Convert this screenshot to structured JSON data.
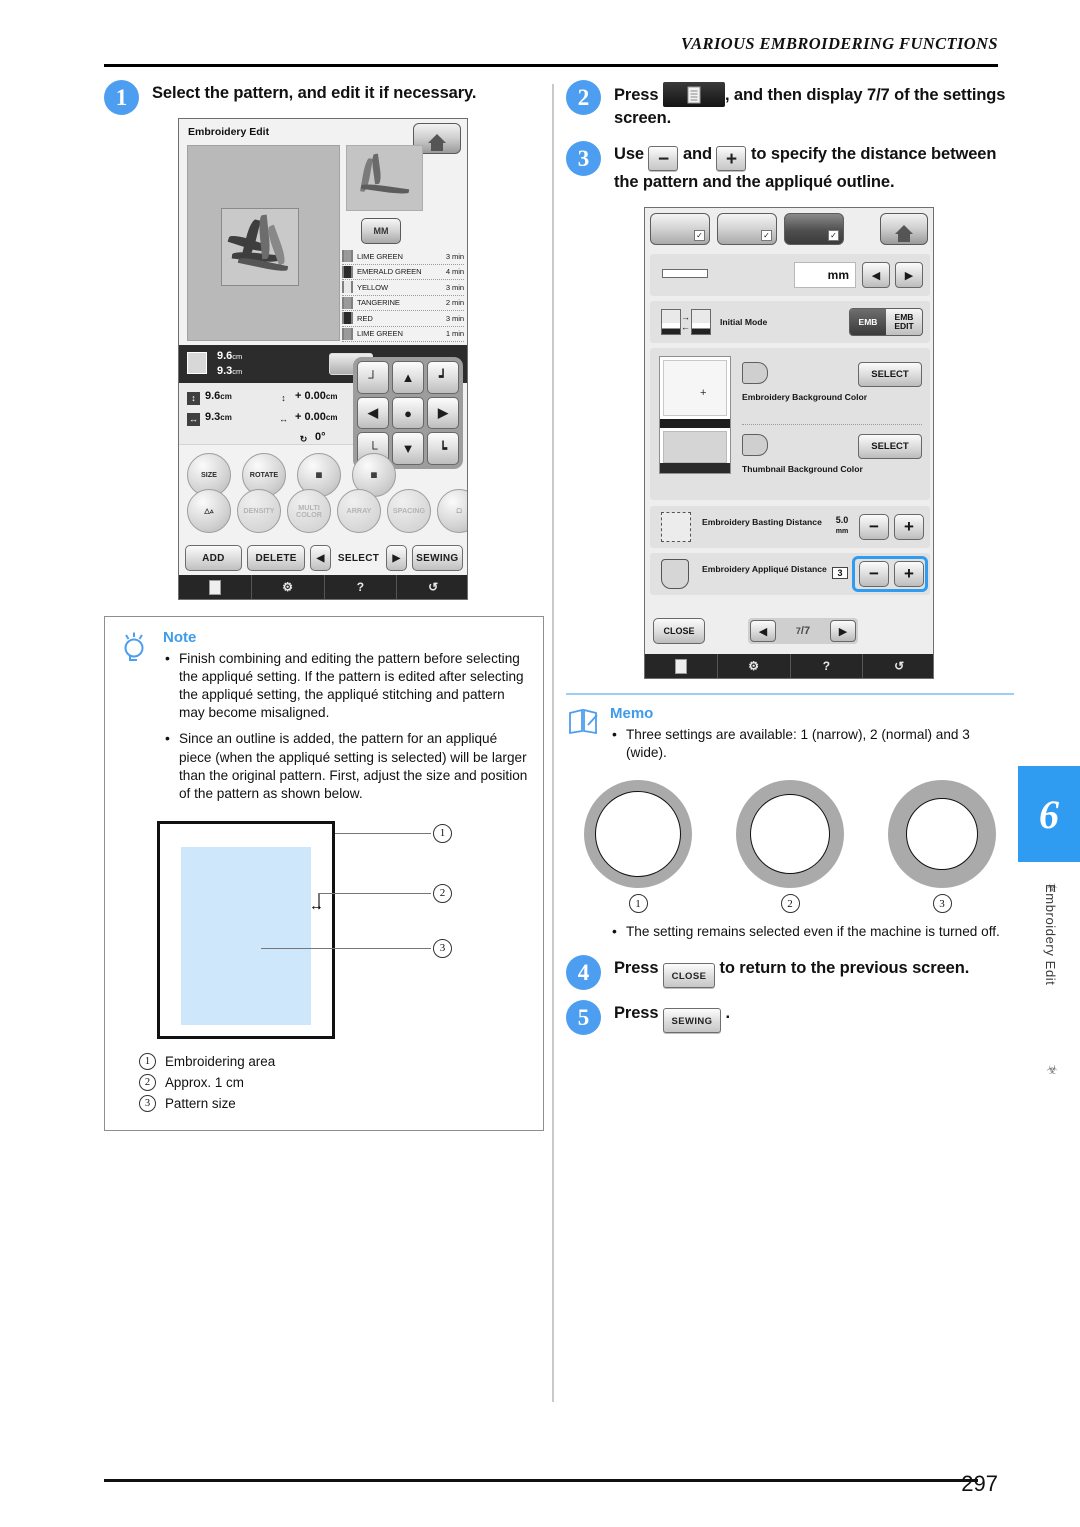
{
  "header": {
    "title": "VARIOUS EMBROIDERING FUNCTIONS"
  },
  "footer": {
    "page_number": "297"
  },
  "sidebar": {
    "chapter_number": "6",
    "chapter_label": "Embroidery Edit"
  },
  "steps": {
    "step1": {
      "num": "1",
      "text": "Select the pattern, and edit it if necessary."
    },
    "step2": {
      "num": "2",
      "text_before": "Press",
      "text_after": ", and then display 7/7 of the settings screen."
    },
    "step3": {
      "num": "3",
      "text_before": "Use",
      "text_mid": "and",
      "text_after": "to specify the distance between the pattern and the appliqué outline.",
      "minus": "−",
      "plus": "+"
    },
    "step4": {
      "num": "4",
      "text_before": "Press",
      "button": "CLOSE",
      "text_after": "to return to the previous screen."
    },
    "step5": {
      "num": "5",
      "text_before": "Press",
      "button": "SEWING",
      "text_after": "."
    }
  },
  "embroidery_edit_screen": {
    "title": "Embroidery Edit",
    "home_icon": "home-icon",
    "thread_colors": [
      {
        "name": "LIME GREEN",
        "time": "3 min",
        "swatch": "s-mid"
      },
      {
        "name": "EMERALD GREEN",
        "time": "4 min",
        "swatch": "s-dark"
      },
      {
        "name": "YELLOW",
        "time": "3 min",
        "swatch": "s-light"
      },
      {
        "name": "TANGERINE",
        "time": "2 min",
        "swatch": "s-mid"
      },
      {
        "name": "RED",
        "time": "3 min",
        "swatch": "s-dark"
      },
      {
        "name": "LIME GREEN",
        "time": "1 min",
        "swatch": "s-mid"
      }
    ],
    "info_bar": {
      "height": "9.6",
      "width": "9.3",
      "unit": "cm"
    },
    "values": {
      "size_h": "9.6",
      "size_w": "9.3",
      "unit": "cm",
      "offset_v": "+ 0.00",
      "offset_h": "+ 0.00",
      "rotation": "0°"
    },
    "round_buttons_row1": [
      "SIZE",
      "ROTATE",
      "",
      ""
    ],
    "round_buttons_row2": [
      "",
      "DENSITY",
      "MULTI COLOR",
      "ARRAY",
      "SPACING",
      ""
    ],
    "bottom_buttons": {
      "add": "ADD",
      "delete": "DELETE",
      "select": "SELECT",
      "sewing": "SEWING"
    },
    "taskbar": [
      "settings-icon",
      "machine-guide-icon",
      "?",
      "maintenance-icon"
    ]
  },
  "settings_screen": {
    "tabs": [
      "manual-tab",
      "machine-tab",
      "embroidery-tab"
    ],
    "home_icon": "home-icon",
    "rows": {
      "unit": {
        "icon": "ruler-icon",
        "value": "mm",
        "prev": "◀",
        "next": "▶"
      },
      "initial_mode": {
        "label": "Initial Mode",
        "option_selected": "EMB",
        "option_other": "EMB EDIT"
      },
      "embroidery_background": {
        "label": "Embroidery Background Color",
        "button": "SELECT"
      },
      "thumbnail_background": {
        "label": "Thumbnail Background Color",
        "button": "SELECT"
      },
      "basting_distance": {
        "label": "Embroidery Basting Distance",
        "value": "5.0",
        "unit": "mm",
        "minus": "−",
        "plus": "+"
      },
      "applique_distance": {
        "label": "Embroidery Appliqué Distance",
        "value": "3",
        "minus": "−",
        "plus": "+",
        "highlighted": true
      }
    },
    "close_button": "CLOSE",
    "pager": {
      "prev": "◀",
      "current": "7",
      "total": "7",
      "next": "▶"
    },
    "taskbar": [
      "settings-icon",
      "machine-guide-icon",
      "?",
      "maintenance-icon"
    ]
  },
  "note": {
    "heading": "Note",
    "bullets": [
      "Finish combining and editing the pattern before selecting the appliqué setting. If the pattern is edited after selecting the appliqué setting, the appliqué stitching and pattern may become misaligned.",
      "Since an outline is added, the pattern for an appliqué piece (when the appliqué setting is selected) will be larger than the original pattern. First, adjust the size and position of the pattern as shown below."
    ],
    "diagram_callouts": [
      "1",
      "2",
      "3"
    ],
    "legend": [
      {
        "num": "1",
        "text": "Embroidering area"
      },
      {
        "num": "2",
        "text": "Approx. 1 cm"
      },
      {
        "num": "3",
        "text": "Pattern size"
      }
    ]
  },
  "memo": {
    "heading": "Memo",
    "bullets": [
      "Three settings are available: 1 (narrow), 2 (normal) and 3 (wide).",
      "The setting remains selected even if the machine is turned off."
    ],
    "circle_labels": [
      "1",
      "2",
      "3"
    ]
  },
  "colors": {
    "accent_blue": "#4d9ef0",
    "chapter_tab_blue": "#2f9cf2",
    "diagram_fill": "#cfe7fa",
    "highlight_border": "#2f9cf2"
  }
}
